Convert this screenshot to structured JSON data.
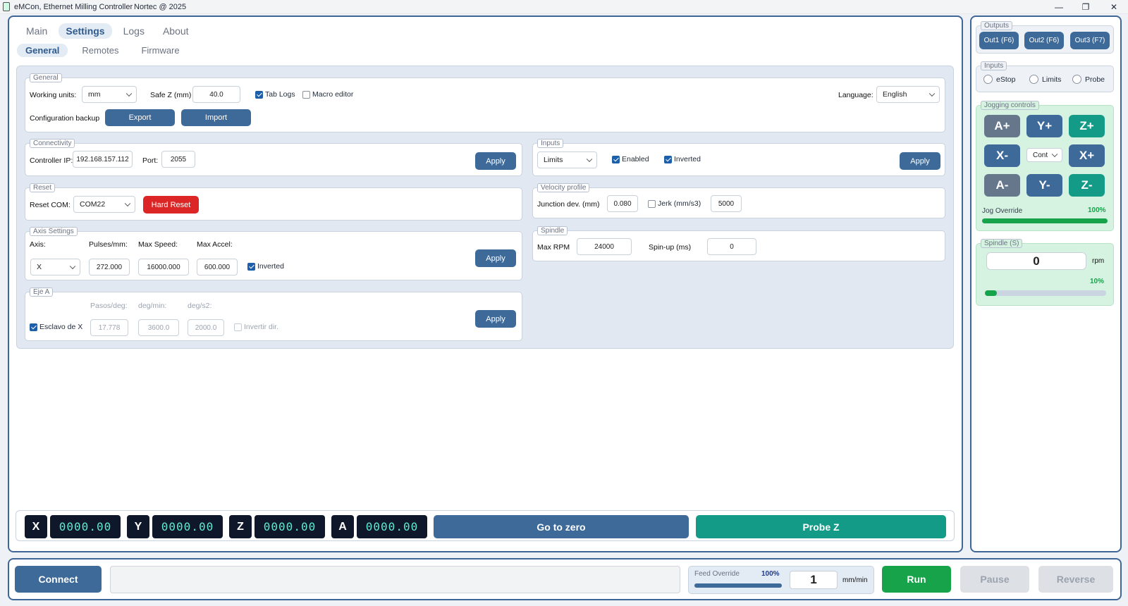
{
  "titlebar": {
    "title": "eMCon, Ethernet Milling Controller",
    "copyright": "Nortec @ 2025",
    "min": "—",
    "max": "❐",
    "close": "✕"
  },
  "tabs": [
    "Main",
    "Settings",
    "Logs",
    "About"
  ],
  "subtabs": [
    "General",
    "Remotes",
    "Firmware"
  ],
  "general": {
    "legend": "General",
    "working_units_label": "Working units:",
    "working_units": "mm",
    "safe_z_label": "Safe Z (mm)",
    "safe_z": "40.0",
    "tab_logs": "Tab Logs",
    "macro_editor": "Macro editor",
    "language_label": "Language:",
    "language": "English",
    "backup_label": "Configuration backup",
    "export": "Export",
    "import": "Import"
  },
  "connectivity": {
    "legend": "Connectivity",
    "ip_label": "Controller IP:",
    "ip": "192.168.157.112",
    "port_label": "Port:",
    "port": "2055",
    "apply": "Apply"
  },
  "inputs_cfg": {
    "legend": "Inputs",
    "select": "Limits",
    "enabled": "Enabled",
    "inverted": "Inverted",
    "apply": "Apply"
  },
  "reset": {
    "legend": "Reset",
    "com_label": "Reset COM:",
    "com": "COM22",
    "hard_reset": "Hard Reset"
  },
  "velocity": {
    "legend": "Velocity profile",
    "junction_label": "Junction dev. (mm)",
    "junction": "0.080",
    "jerk_label": "Jerk (mm/s3)",
    "jerk": "5000"
  },
  "axis": {
    "legend": "Axis Settings",
    "axis_label": "Axis:",
    "pulses_label": "Pulses/mm:",
    "speed_label": "Max Speed:",
    "accel_label": "Max Accel:",
    "axis": "X",
    "pulses": "272.000",
    "speed": "16000.000",
    "accel": "600.000",
    "inverted": "Inverted",
    "apply": "Apply"
  },
  "spindle_cfg": {
    "legend": "Spindle",
    "rpm_label": "Max RPM",
    "rpm": "24000",
    "spinup_label": "Spin-up (ms)",
    "spinup": "0"
  },
  "eje_a": {
    "legend": "Eje A",
    "pasos_label": "Pasos/deg:",
    "degmin_label": "deg/min:",
    "degs2_label": "deg/s2:",
    "slave": "Esclavo de X",
    "pasos": "17.778",
    "degmin": "3600.0",
    "degs2": "2000.0",
    "invert": "Invertir dir.",
    "apply": "Apply"
  },
  "dro": {
    "x_label": "X",
    "x": "0000.00",
    "y_label": "Y",
    "y": "0000.00",
    "z_label": "Z",
    "z": "0000.00",
    "a_label": "A",
    "a": "0000.00",
    "go_zero": "Go to zero",
    "probe_z": "Probe Z"
  },
  "outputs": {
    "legend": "Outputs",
    "out1": "Out1 (F6)",
    "out2": "Out2 (F6)",
    "out3": "Out3 (F7)"
  },
  "inputs_status": {
    "legend": "Inputs",
    "estop": "eStop",
    "limits": "Limits",
    "probe": "Probe"
  },
  "jogging": {
    "legend": "Jogging controls",
    "a_plus": "A+",
    "y_plus": "Y+",
    "z_plus": "Z+",
    "x_minus": "X-",
    "mode": "Cont",
    "x_plus": "X+",
    "a_minus": "A-",
    "y_minus": "Y-",
    "z_minus": "Z-",
    "override_label": "Jog Override",
    "override_value": "100%",
    "override_fraction": 1.0
  },
  "spindle_panel": {
    "legend": "Spindle (S)",
    "rpm": "0",
    "unit": "rpm",
    "percent": "10%",
    "fraction": 0.1
  },
  "bottom": {
    "connect": "Connect",
    "status": "",
    "feed_label": "Feed Override",
    "feed_value": "100%",
    "feed_fraction": 1.0,
    "feed": "1",
    "feed_unit": "mm/min",
    "run": "Run",
    "pause": "Pause",
    "reverse": "Reverse"
  },
  "colors": {
    "accent": "#3e6a9a",
    "teal": "#139b87",
    "run": "#16a34a",
    "reset": "#dc2626",
    "jog_bg": "#d6f3e1"
  }
}
